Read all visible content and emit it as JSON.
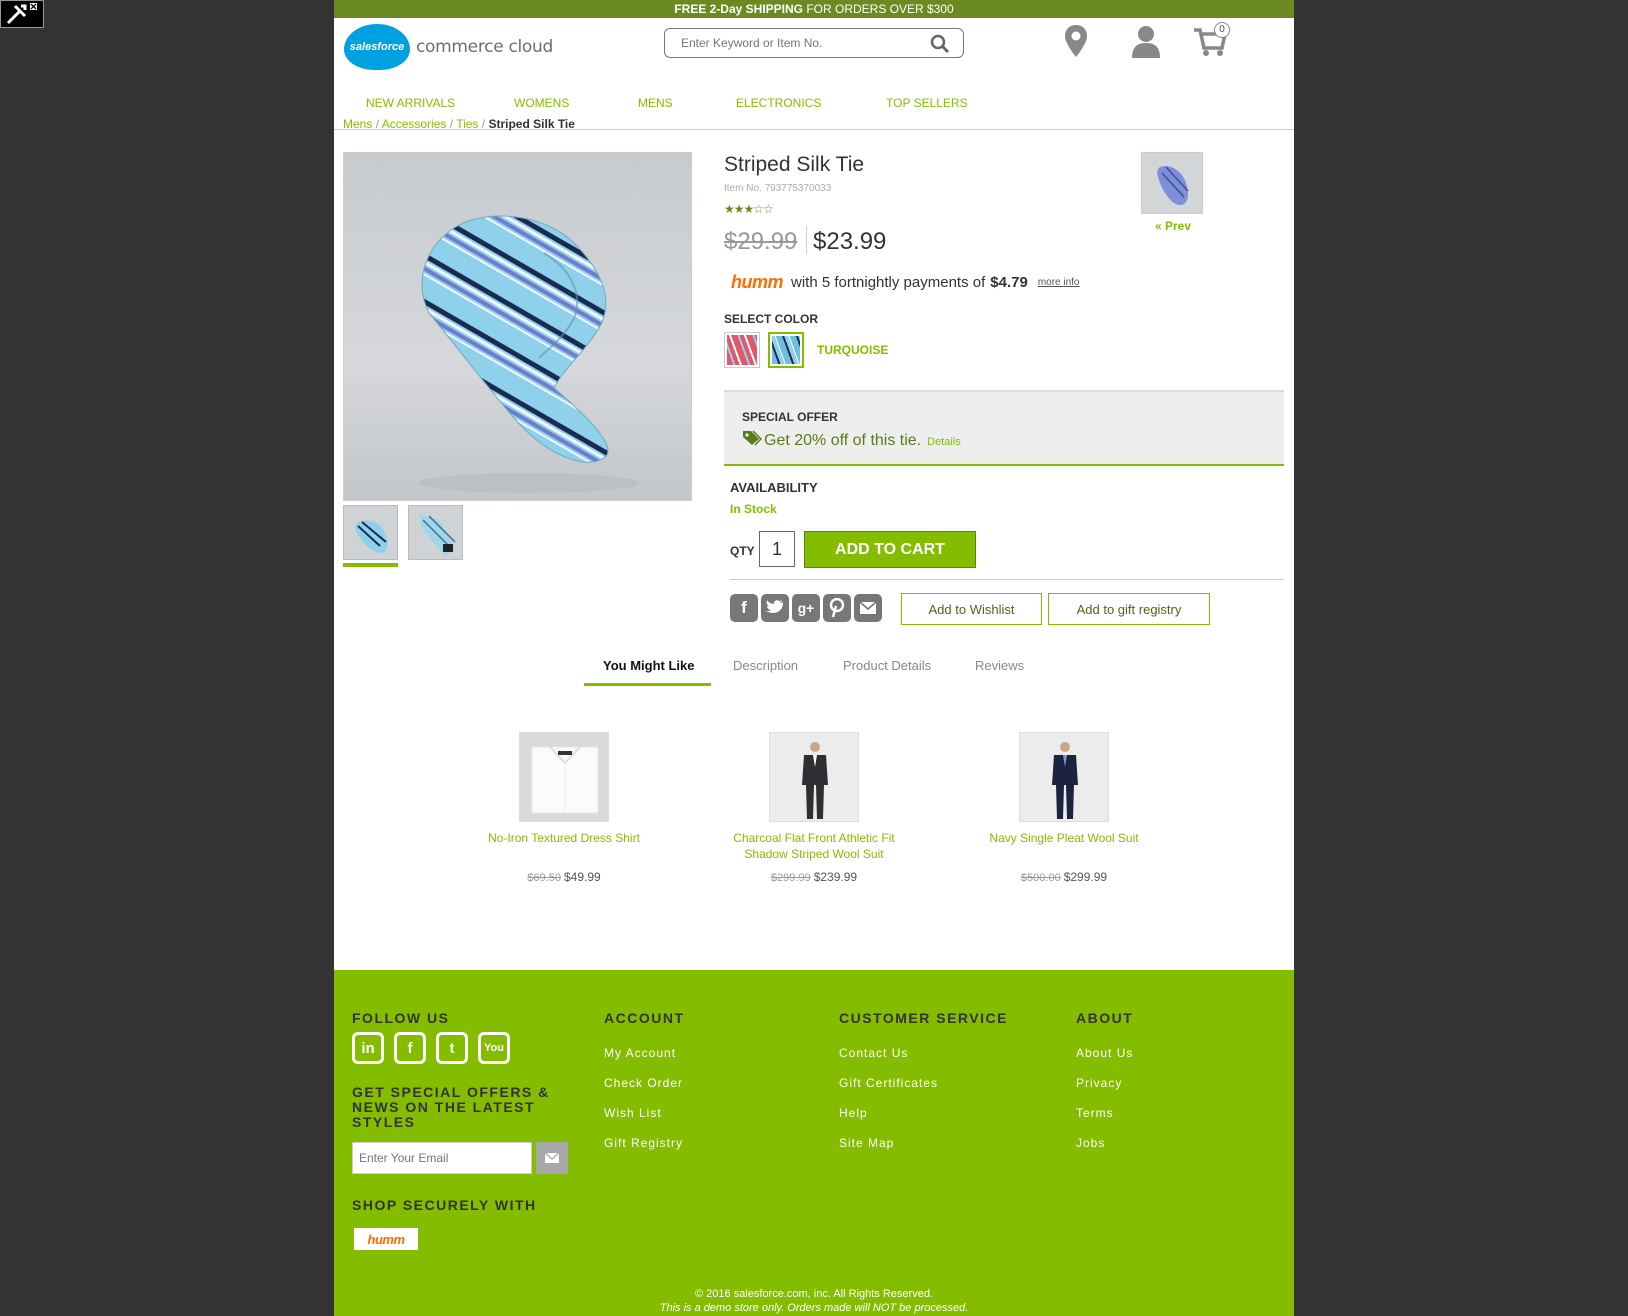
{
  "promo": {
    "bold": "FREE 2-Day SHIPPING",
    "rest": " FOR ORDERS OVER $300"
  },
  "brand": {
    "cloud_text": "salesforce",
    "name": "commerce cloud"
  },
  "search": {
    "placeholder": "Enter Keyword or Item No."
  },
  "cart": {
    "count": "0"
  },
  "nav": [
    "NEW ARRIVALS",
    "WOMENS",
    "MENS",
    "ELECTRONICS",
    "TOP SELLERS"
  ],
  "breadcrumb": {
    "items": [
      "Mens",
      "Accessories",
      "Ties"
    ],
    "current": "Striped Silk Tie",
    "separator": "/"
  },
  "product": {
    "title": "Striped Silk Tie",
    "item_no": "Item No. 793775370033",
    "rating": 2.5,
    "stars_text": "★★★☆☆",
    "price_old": "$29.99",
    "price_new": "$23.99",
    "humm": {
      "logo": "humm",
      "text": "with 5 fortnightly payments of",
      "amount": "$4.79",
      "more": "more info"
    },
    "select_color_label": "SELECT COLOR",
    "selected_color": "TURQUOISE",
    "offer": {
      "title": "SPECIAL OFFER",
      "text": "Get 20% off of this tie.",
      "details": "Details"
    },
    "availability": {
      "label": "AVAILABILITY",
      "value": "In Stock"
    },
    "qty": {
      "label": "QTY",
      "value": "1"
    },
    "add_to_cart": "ADD TO CART",
    "add_to_wishlist": "Add to Wishlist",
    "add_to_registry": "Add to gift registry",
    "prev": "« Prev"
  },
  "share_icons": [
    "facebook-icon",
    "twitter-icon",
    "google-plus-icon",
    "pinterest-icon",
    "email-icon"
  ],
  "tabs": [
    "You Might Like",
    "Description",
    "Product Details",
    "Reviews"
  ],
  "recommendations": [
    {
      "name": "No-Iron Textured Dress Shirt",
      "old": "$69.50",
      "price": "$49.99"
    },
    {
      "name": "Charcoal Flat Front Athletic Fit Shadow Striped Wool Suit",
      "old": "$299.99",
      "price": "$239.99"
    },
    {
      "name": "Navy Single Pleat Wool Suit",
      "old": "$500.00",
      "price": "$299.99"
    }
  ],
  "footer": {
    "follow": "FOLLOW US",
    "social": [
      "in",
      "f",
      "t",
      "You"
    ],
    "signup": "GET SPECIAL OFFERS & NEWS ON THE LATEST STYLES",
    "email_placeholder": "Enter Your Email",
    "shop_secure": "SHOP SECURELY WITH",
    "humm": "humm",
    "account": {
      "title": "ACCOUNT",
      "links": [
        "My Account",
        "Check Order",
        "Wish List",
        "Gift Registry"
      ]
    },
    "service": {
      "title": "CUSTOMER SERVICE",
      "links": [
        "Contact Us",
        "Gift Certificates",
        "Help",
        "Site Map"
      ]
    },
    "about": {
      "title": "ABOUT",
      "links": [
        "About Us",
        "Privacy",
        "Terms",
        "Jobs"
      ]
    },
    "copyright": "© 2016 salesforce.com, inc. All Rights Reserved.",
    "demo_notice": "This is a demo store only. Orders made will NOT be processed."
  },
  "colors": {
    "accent": "#84bd00",
    "promo_bar": "#6b8a22",
    "humm": "#ff6c00",
    "backdrop": "#333333"
  }
}
